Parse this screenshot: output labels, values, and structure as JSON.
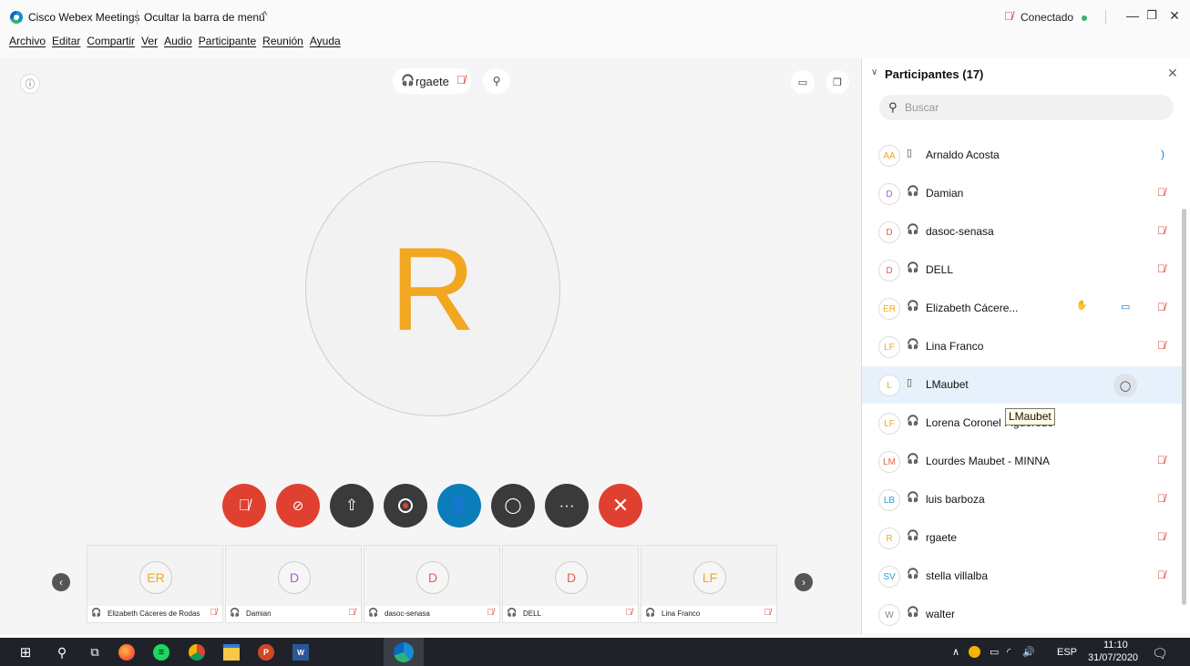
{
  "titlebar": {
    "app_title": "Cisco Webex Meetings",
    "hide_menu": "Ocultar la barra de menú",
    "hide_menu_caret": "^",
    "status": "Conectado",
    "status_color": "#2bb673",
    "minimize": "—",
    "restore": "❐",
    "close": "✕"
  },
  "menu": [
    "Archivo",
    "Editar",
    "Compartir",
    "Ver",
    "Audio",
    "Participante",
    "Reunión",
    "Ayuda"
  ],
  "stage": {
    "active_speaker": "rgaete",
    "big_initial": "R",
    "accent": "#f2a721"
  },
  "controls": {
    "mute_icon": "mic-muted-icon",
    "video_icon": "video-off-icon",
    "share_icon": "share-icon",
    "record_icon": "record-icon",
    "participants_icon": "participants-icon",
    "chat_icon": "chat-icon",
    "more_icon": "more-icon",
    "leave_icon": "close-icon",
    "more_glyph": "···",
    "leave_glyph": "✕"
  },
  "filmstrip": [
    {
      "initials": "ER",
      "name": "Elizabeth Cáceres de Rodas",
      "color": "#f2a721"
    },
    {
      "initials": "D",
      "name": "Damian",
      "color": "#a45ec4"
    },
    {
      "initials": "D",
      "name": "dasoc-senasa",
      "color": "#e0604f"
    },
    {
      "initials": "D",
      "name": "DELL",
      "color": "#e0604f"
    },
    {
      "initials": "LF",
      "name": "Lina Franco",
      "color": "#f2a721"
    }
  ],
  "panel": {
    "title": "Participantes (17)",
    "search_placeholder": "Buscar",
    "tooltip": "LMaubet",
    "participants": [
      {
        "initials": "AA",
        "name": "Arnaldo Acosta",
        "device": "phone",
        "status": "audio",
        "color": "#f2a721"
      },
      {
        "initials": "D",
        "name": "Damian",
        "device": "headset",
        "status": "muted",
        "color": "#a45ec4"
      },
      {
        "initials": "D",
        "name": "dasoc-senasa",
        "device": "headset",
        "status": "muted",
        "color": "#e0604f"
      },
      {
        "initials": "D",
        "name": "DELL",
        "device": "headset",
        "status": "muted",
        "color": "#e0604f"
      },
      {
        "initials": "ER",
        "name": "Elizabeth Cácere...",
        "device": "headset",
        "status": "muted",
        "hand": true,
        "video": true,
        "color": "#f2a721"
      },
      {
        "initials": "LF",
        "name": "Lina Franco",
        "device": "headset",
        "status": "muted",
        "color": "#f2a721"
      },
      {
        "initials": "L",
        "name": "LMaubet",
        "device": "phone",
        "status": "none",
        "selected": true,
        "chat": true,
        "color": "#f2a721"
      },
      {
        "initials": "LF",
        "name": "Lorena Coronel Figueredo",
        "device": "headset",
        "status": "none",
        "color": "#f2a721"
      },
      {
        "initials": "LM",
        "name": "Lourdes Maubet - MINNA",
        "device": "headset",
        "status": "muted",
        "color": "#e0604f"
      },
      {
        "initials": "LB",
        "name": "luis barboza",
        "device": "headset",
        "status": "muted",
        "color": "#2a9bd6"
      },
      {
        "initials": "R",
        "name": "rgaete",
        "device": "headset",
        "status": "muted",
        "color": "#f2a721"
      },
      {
        "initials": "SV",
        "name": "stella villalba",
        "device": "headset",
        "status": "muted",
        "color": "#2a9bd6"
      },
      {
        "initials": "W",
        "name": "walter",
        "device": "headset",
        "status": "none",
        "color": "#888888"
      }
    ]
  },
  "taskbar": {
    "lang": "ESP",
    "time": "11:10",
    "date": "31/07/2020",
    "word_label": "W",
    "ppt_label": "P"
  }
}
